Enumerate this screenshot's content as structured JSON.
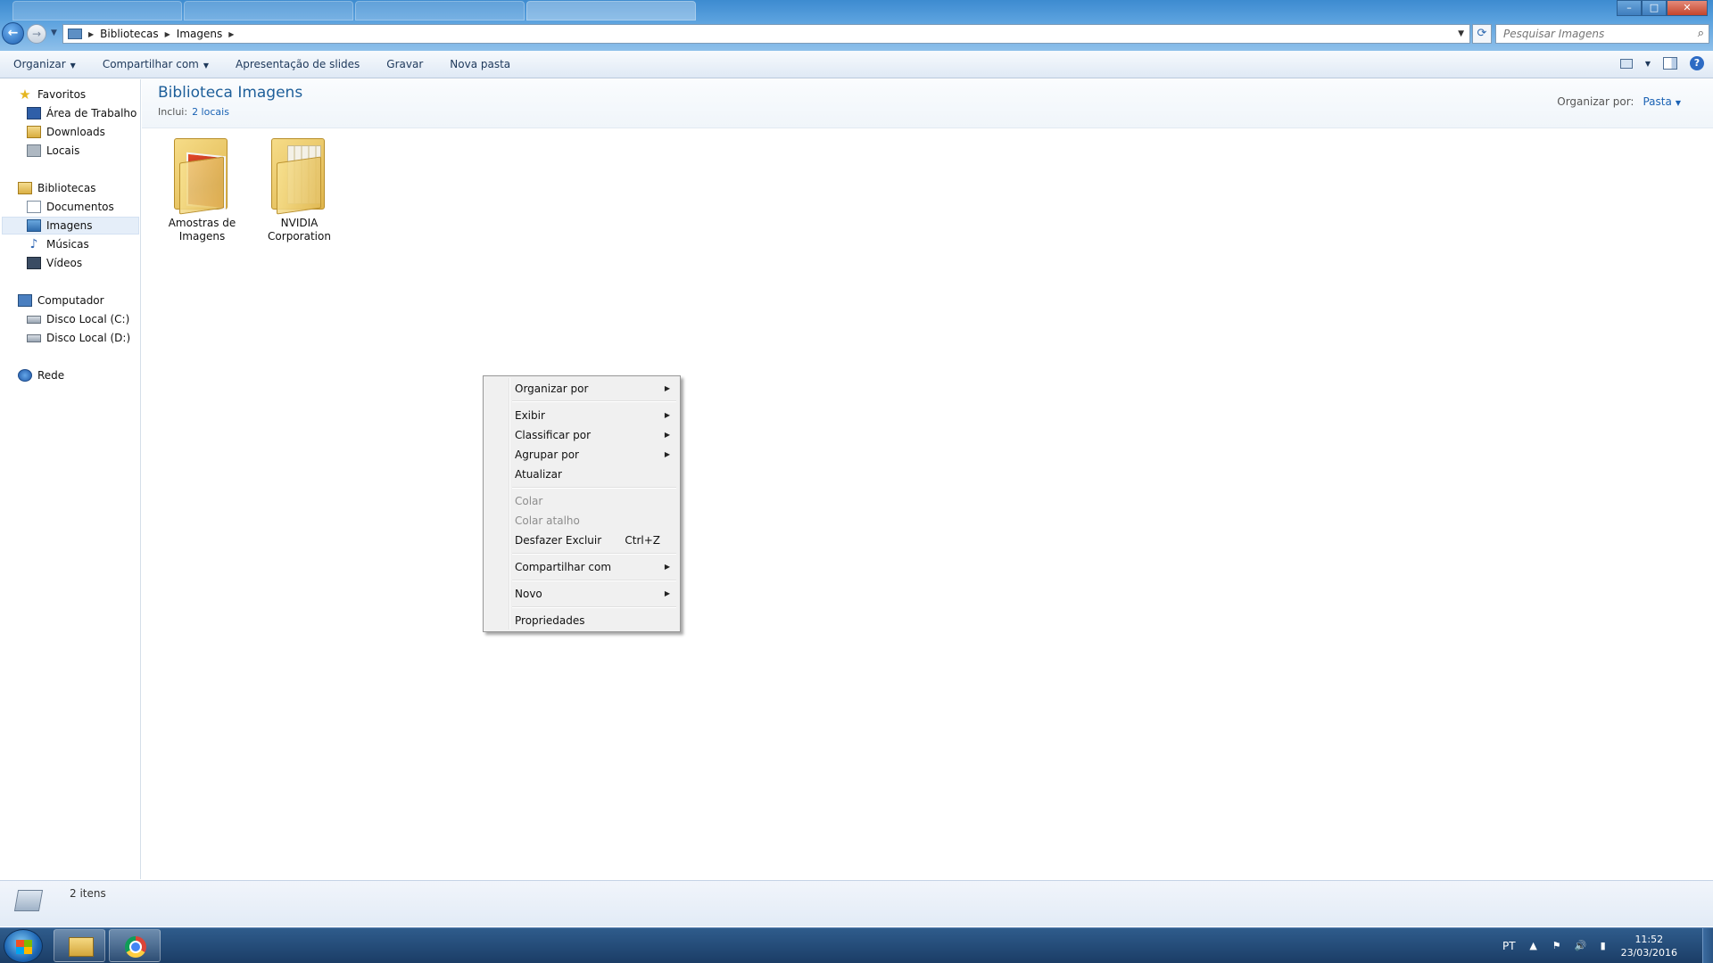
{
  "window": {
    "controls": {
      "minimize": "–",
      "maximize": "□",
      "close": "✕"
    }
  },
  "address": {
    "breadcrumbs": [
      "Bibliotecas",
      "Imagens"
    ],
    "search_placeholder": "Pesquisar Imagens"
  },
  "toolbar": {
    "organize": "Organizar",
    "share": "Compartilhar com",
    "slideshow": "Apresentação de slides",
    "burn": "Gravar",
    "new_folder": "Nova pasta",
    "help": "?"
  },
  "nav": {
    "favorites": "Favoritos",
    "desktop": "Área de Trabalho",
    "downloads": "Downloads",
    "places": "Locais",
    "libraries": "Bibliotecas",
    "documents": "Documentos",
    "images": "Imagens",
    "music": "Músicas",
    "videos": "Vídeos",
    "computer": "Computador",
    "disk_c": "Disco Local (C:)",
    "disk_d": "Disco Local (D:)",
    "network": "Rede"
  },
  "library": {
    "title": "Biblioteca Imagens",
    "includes_label": "Inclui:",
    "includes_link": "2 locais",
    "arrange_label": "Organizar por:",
    "arrange_value": "Pasta"
  },
  "items": [
    {
      "line1": "Amostras de",
      "line2": "Imagens"
    },
    {
      "line1": "NVIDIA",
      "line2": "Corporation"
    }
  ],
  "context_menu": {
    "arrange_by": "Organizar por",
    "view": "Exibir",
    "sort_by": "Classificar por",
    "group_by": "Agrupar por",
    "refresh": "Atualizar",
    "paste": "Colar",
    "paste_shortcut": "Colar atalho",
    "undo_delete": "Desfazer Excluir",
    "undo_shortcut_key": "Ctrl+Z",
    "share_with": "Compartilhar com",
    "new": "Novo",
    "properties": "Propriedades"
  },
  "status": {
    "count": "2 itens"
  },
  "taskbar": {
    "language": "PT",
    "time": "11:52",
    "date": "23/03/2016"
  }
}
